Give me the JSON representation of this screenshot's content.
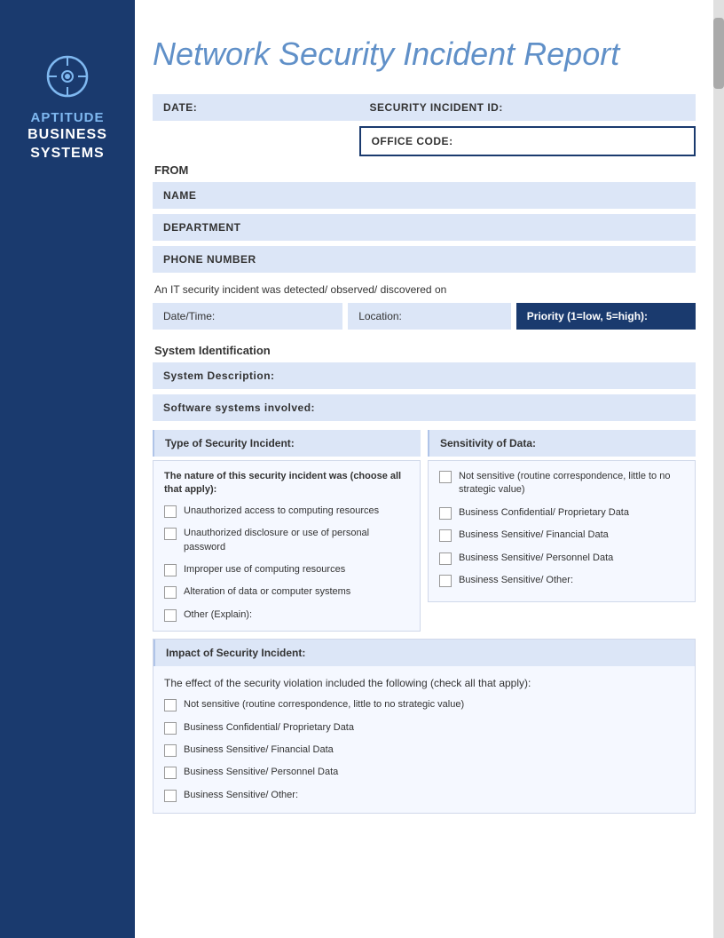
{
  "sidebar": {
    "icon_label": "aptitude-icon",
    "brand_top": "APTITUDE",
    "brand_bottom_line1": "BUSINESS",
    "brand_bottom_line2": "SYSTEMS"
  },
  "header": {
    "title": "Network Security Incident Report"
  },
  "form": {
    "date_label": "DATE:",
    "security_incident_id_label": "SECURITY INCIDENT ID:",
    "office_code_label": "OFFICE CODE:",
    "from_label": "FROM",
    "name_label": "NAME",
    "department_label": "DEPARTMENT",
    "phone_label": "PHONE NUMBER",
    "incident_detected_text": "An IT security incident was detected/ observed/ discovered on",
    "date_time_label": "Date/Time:",
    "location_label": "Location:",
    "priority_label": "Priority (1=low, 5=high):",
    "system_identification_label": "System Identification",
    "system_description_label": "System Description:",
    "software_systems_label": "Software systems involved:",
    "type_of_incident_header": "Type of Security Incident:",
    "sensitivity_header": "Sensitivity of Data:",
    "nature_text": "The nature of this security incident was (choose all that apply):",
    "type_checkboxes": [
      "Unauthorized access to computing resources",
      "Unauthorized disclosure or use of personal password",
      "Improper use of computing resources",
      "Alteration of data or computer systems",
      "Other (Explain):"
    ],
    "sensitivity_checkboxes": [
      "Not sensitive (routine correspondence, little to no strategic value)",
      "Business Confidential/ Proprietary Data",
      "Business Sensitive/ Financial Data",
      "Business Sensitive/ Personnel Data",
      "Business Sensitive/ Other:"
    ],
    "impact_header": "Impact of Security Incident:",
    "impact_effect_text": "The effect of the security violation included the following (check all that apply):",
    "impact_checkboxes": [
      "Not sensitive (routine correspondence, little to no strategic value)",
      "Business Confidential/ Proprietary Data",
      "Business Sensitive/ Financial Data",
      "Business Sensitive/ Personnel Data",
      "Business Sensitive/ Other:"
    ]
  }
}
